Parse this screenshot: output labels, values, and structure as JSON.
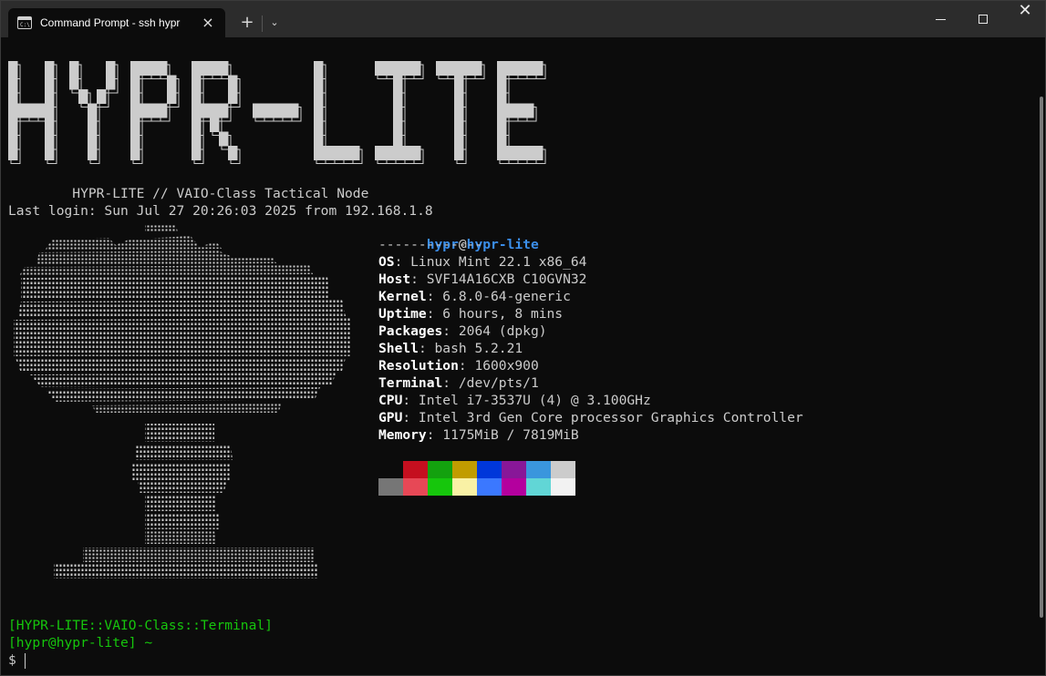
{
  "window": {
    "tab_title": "Command Prompt - ssh  hypr",
    "tab_close_icon": "close-icon",
    "new_tab_label": "+",
    "dropdown_icon": "chevron-down-icon",
    "minimize_icon": "minimize-icon",
    "maximize_icon": "maximize-icon",
    "close_icon": "close-icon"
  },
  "terminal": {
    "banner_text": "HYPR-LITE",
    "motd": "        HYPR-LITE // VAIO-Class Tactical Node",
    "last_login": "Last login: Sun Jul 27 20:26:03 2025 from 192.168.1.8",
    "ascii_art_subject": "mushroom-cloud",
    "user": "hypr",
    "at": "@",
    "host": "hypr-lite",
    "separator": "-------------",
    "info": [
      {
        "key": "OS",
        "value": ": Linux Mint 22.1 x86_64"
      },
      {
        "key": "Host",
        "value": ": SVF14A16CXB C10GVN32"
      },
      {
        "key": "Kernel",
        "value": ": 6.8.0-64-generic"
      },
      {
        "key": "Uptime",
        "value": ": 6 hours, 8 mins"
      },
      {
        "key": "Packages",
        "value": ": 2064 (dpkg)"
      },
      {
        "key": "Shell",
        "value": ": bash 5.2.21"
      },
      {
        "key": "Resolution",
        "value": ": 1600x900"
      },
      {
        "key": "Terminal",
        "value": ": /dev/pts/1"
      },
      {
        "key": "CPU",
        "value": ": Intel i7-3537U (4) @ 3.100GHz"
      },
      {
        "key": "GPU",
        "value": ": Intel 3rd Gen Core processor Graphics Controller"
      },
      {
        "key": "Memory",
        "value": ": 1175MiB / 7819MiB"
      }
    ],
    "palette_top": [
      "#0c0c0c",
      "#c50f1f",
      "#13a10e",
      "#c19c00",
      "#0037da",
      "#881798",
      "#3a96dd",
      "#cccccc"
    ],
    "palette_bottom": [
      "#767676",
      "#e74856",
      "#16c60c",
      "#f9f1a5",
      "#3b78ff",
      "#b4009e",
      "#61d6d6",
      "#f2f2f2"
    ],
    "prompt_banner": "[HYPR-LITE::VAIO-Class::Terminal]",
    "prompt_user": "[hypr@hypr-lite] ~",
    "prompt_symbol": "$"
  },
  "colors": {
    "background": "#0c0c0c",
    "text": "#cccccc",
    "accent_blue": "#3b8eea",
    "prompt_green": "#16c60c"
  }
}
